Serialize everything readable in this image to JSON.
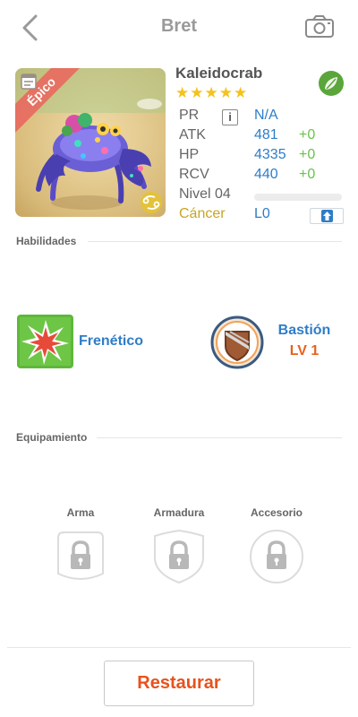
{
  "header": {
    "title": "Bret"
  },
  "monster": {
    "name": "Kaleidocrab",
    "stars": "★★★★★",
    "rarity": "Épico",
    "element": "leaf"
  },
  "stats": {
    "pr": {
      "label": "PR",
      "value": "N/A"
    },
    "atk": {
      "label": "ATK",
      "value": "481",
      "bonus": "+0"
    },
    "hp": {
      "label": "HP",
      "value": "4335",
      "bonus": "+0"
    },
    "rcv": {
      "label": "RCV",
      "value": "440",
      "bonus": "+0"
    },
    "level": {
      "label": "Nivel 04",
      "progress": 0
    },
    "sign": {
      "label": "Cáncer",
      "value": "L0"
    }
  },
  "abilities": {
    "section_label": "Habilidades",
    "first": {
      "name": "Frenético"
    },
    "second": {
      "name": "Bastión",
      "level": "LV 1"
    }
  },
  "equipment": {
    "section_label": "Equipamiento",
    "slots": [
      "Arma",
      "Armadura",
      "Accesorio"
    ]
  },
  "actions": {
    "restore_label": "Restaurar"
  },
  "colors": {
    "accent_blue": "#2f7dc7",
    "accent_orange": "#e8621c",
    "bonus_green": "#6bc24a",
    "star_yellow": "#f4c21b",
    "rarity_red": "#e86a5f"
  }
}
